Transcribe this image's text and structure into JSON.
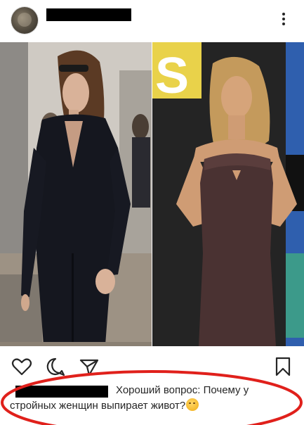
{
  "post": {
    "username_redacted": true,
    "more_icon": "more-vertical-icon",
    "photo": {
      "left_panel": "photo-left",
      "right_panel": "photo-right",
      "right_backdrop_text": "S"
    }
  },
  "actions": {
    "like_icon": "heart-icon",
    "comment_icon": "comment-icon",
    "share_icon": "send-icon",
    "save_icon": "bookmark-icon"
  },
  "comment": {
    "author_redacted": true,
    "text": "Хороший вопрос: Почему у стройных женщин выпирает живот?",
    "emoji": "smirking-face-emoji"
  },
  "colors": {
    "text": "#262626",
    "annotation": "#e0201b",
    "redaction": "#000000"
  }
}
